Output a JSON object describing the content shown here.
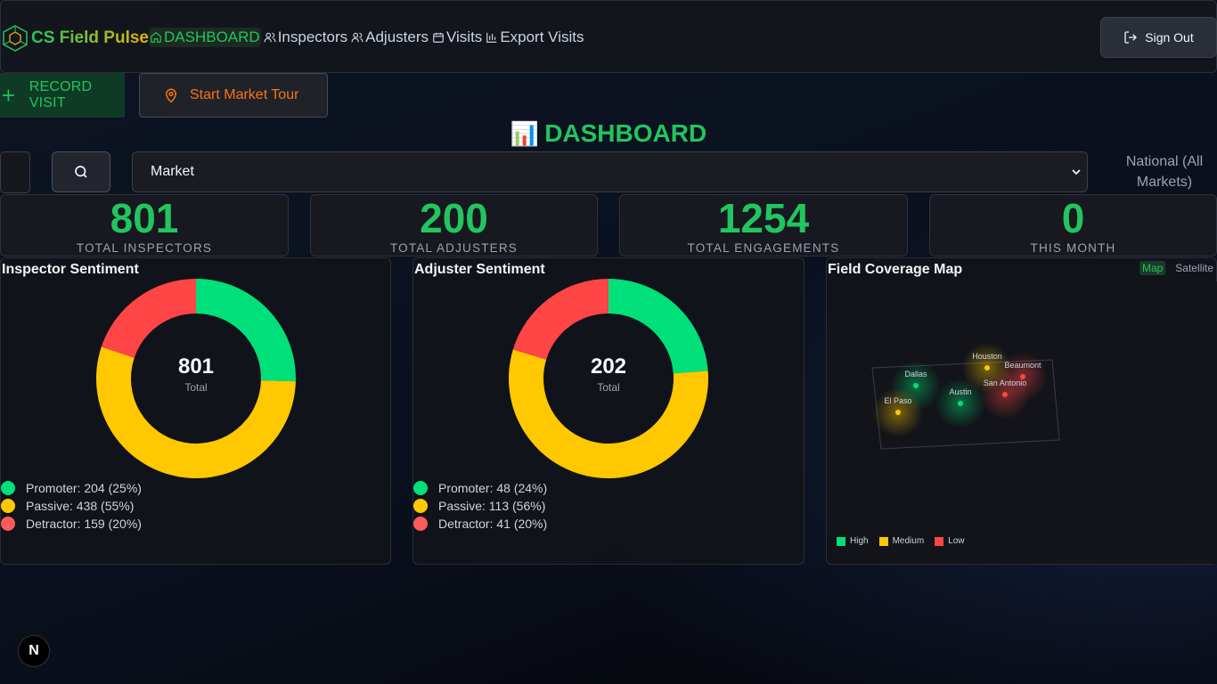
{
  "brand": {
    "name": "CS Field Pulse"
  },
  "nav": {
    "items": [
      {
        "label": "DASHBOARD",
        "active": true,
        "icon": "home-icon"
      },
      {
        "label": "Inspectors",
        "active": false,
        "icon": "users-icon"
      },
      {
        "label": "Adjusters",
        "active": false,
        "icon": "users-icon"
      },
      {
        "label": "Visits",
        "active": false,
        "icon": "calendar-icon"
      },
      {
        "label": "Export Visits",
        "active": false,
        "icon": "bar-chart-icon"
      }
    ],
    "sign_out": "Sign Out"
  },
  "actions": {
    "record_visit": "RECORD VISIT",
    "start_tour": "Start Market Tour"
  },
  "page": {
    "title": "DASHBOARD",
    "title_emoji": "📊"
  },
  "filters": {
    "market_select": "Market",
    "market_label": "National (All Markets)"
  },
  "stats": [
    {
      "value": "801",
      "label": "TOTAL INSPECTORS"
    },
    {
      "value": "200",
      "label": "TOTAL ADJUSTERS"
    },
    {
      "value": "1254",
      "label": "TOTAL ENGAGEMENTS"
    },
    {
      "value": "0",
      "label": "THIS MONTH"
    }
  ],
  "colors": {
    "promoter": "#00e07a",
    "passive": "#ffc800",
    "detractor": "#ff4545",
    "accent": "#22c55e"
  },
  "chart_data": [
    {
      "type": "pie",
      "title": "Inspector Sentiment",
      "center_value": "801",
      "center_label": "Total",
      "categories": [
        "Promoter",
        "Passive",
        "Detractor"
      ],
      "values": [
        204,
        438,
        159
      ],
      "legend": [
        "Promoter: 204 (25%)",
        "Passive: 438 (55%)",
        "Detractor: 159 (20%)"
      ]
    },
    {
      "type": "pie",
      "title": "Adjuster Sentiment",
      "center_value": "202",
      "center_label": "Total",
      "categories": [
        "Promoter",
        "Passive",
        "Detractor"
      ],
      "values": [
        48,
        113,
        41
      ],
      "legend": [
        "Promoter: 48 (24%)",
        "Passive: 113 (56%)",
        "Detractor: 41 (20%)"
      ]
    }
  ],
  "map": {
    "title": "Field Coverage Map",
    "toggle": [
      "Map",
      "Satellite"
    ],
    "markers": [
      {
        "name": "Dallas",
        "level": "high"
      },
      {
        "name": "Houston",
        "level": "medium"
      },
      {
        "name": "Beaumont",
        "level": "low"
      },
      {
        "name": "Austin",
        "level": "high"
      },
      {
        "name": "San Antonio",
        "level": "low"
      },
      {
        "name": "El Paso",
        "level": "medium"
      }
    ],
    "legend": [
      "High",
      "Medium",
      "Low"
    ]
  }
}
